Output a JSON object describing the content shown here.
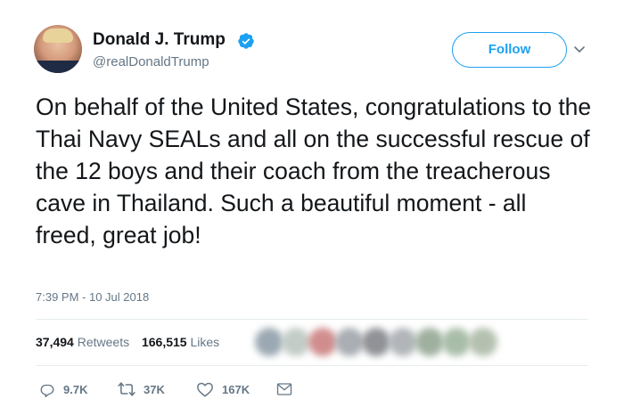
{
  "tweet": {
    "author": {
      "display_name": "Donald J. Trump",
      "handle": "@realDonaldTrump",
      "verified": true,
      "avatar_icon": "user-avatar"
    },
    "follow_label": "Follow",
    "text": "On behalf of the United States, congratulations to the Thai Navy SEALs and all on the successful rescue of the 12 boys and their coach from the treacherous cave in Thailand. Such a beautiful moment - all freed, great job!",
    "timestamp": "7:39 PM - 10 Jul 2018",
    "stats": {
      "retweets_count": "37,494",
      "retweets_label": "Retweets",
      "likes_count": "166,515",
      "likes_label": "Likes"
    },
    "actions": {
      "reply": {
        "icon": "reply-icon",
        "count": "9.7K"
      },
      "retweet": {
        "icon": "retweet-icon",
        "count": "37K"
      },
      "like": {
        "icon": "heart-icon",
        "count": "167K"
      },
      "message": {
        "icon": "envelope-icon"
      }
    }
  },
  "colors": {
    "accent": "#1da1f2",
    "text": "#14171a",
    "secondary": "#657786",
    "divider": "#e6ecf0"
  }
}
